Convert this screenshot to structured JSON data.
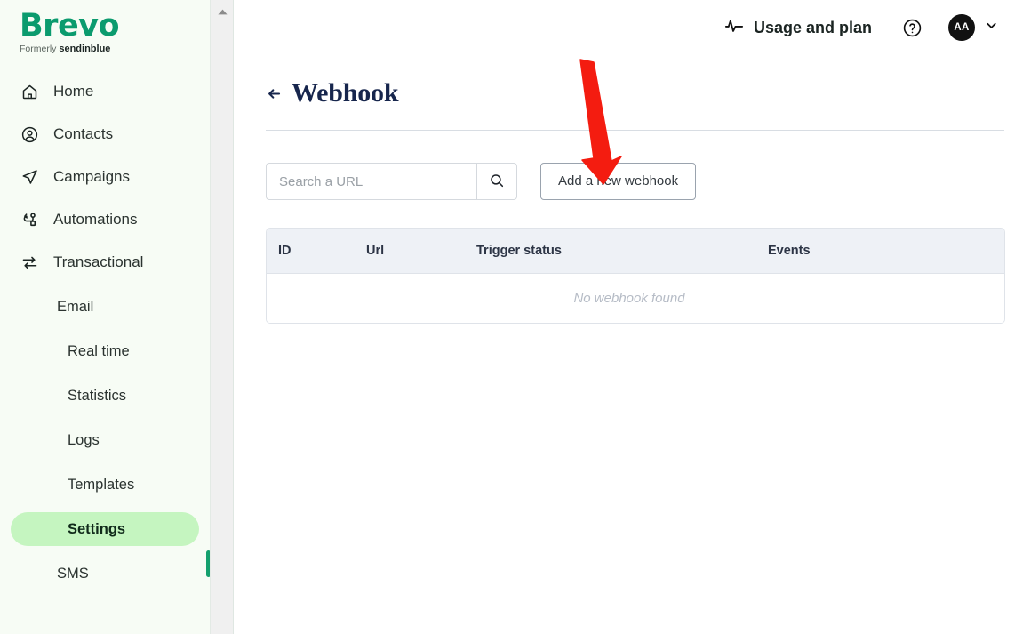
{
  "sidebar": {
    "logo": {
      "word": "Brevo",
      "formerly_prefix": "Formerly",
      "formerly_brand": "sendinblue"
    },
    "items": [
      {
        "label": "Home",
        "icon": "home-icon",
        "level": 1,
        "active": false
      },
      {
        "label": "Contacts",
        "icon": "contacts-icon",
        "level": 1,
        "active": false
      },
      {
        "label": "Campaigns",
        "icon": "campaigns-icon",
        "level": 1,
        "active": false
      },
      {
        "label": "Automations",
        "icon": "automations-icon",
        "level": 1,
        "active": false
      },
      {
        "label": "Transactional",
        "icon": "transactional-icon",
        "level": 1,
        "active": false
      },
      {
        "label": "Email",
        "icon": "",
        "level": 2,
        "active": false
      },
      {
        "label": "Real time",
        "icon": "",
        "level": 3,
        "active": false
      },
      {
        "label": "Statistics",
        "icon": "",
        "level": 3,
        "active": false
      },
      {
        "label": "Logs",
        "icon": "",
        "level": 3,
        "active": false
      },
      {
        "label": "Templates",
        "icon": "",
        "level": 3,
        "active": false
      },
      {
        "label": "Settings",
        "icon": "",
        "level": 3,
        "active": true
      },
      {
        "label": "SMS",
        "icon": "",
        "level": 2,
        "active": false
      }
    ]
  },
  "header": {
    "usage_label": "Usage and plan",
    "usage_icon": "activity-pulse-icon",
    "help_icon": "help-circle-icon",
    "avatar_initials": "AA",
    "chevron_icon": "chevron-down-icon"
  },
  "page": {
    "back_icon": "arrow-left-icon",
    "title": "Webhook"
  },
  "toolbar": {
    "search_placeholder": "Search a URL",
    "search_value": "",
    "search_icon": "search-icon",
    "add_button_label": "Add a new webhook"
  },
  "table": {
    "columns": [
      "ID",
      "Url",
      "Trigger status",
      "Events"
    ],
    "rows": [],
    "empty_message": "No webhook found"
  },
  "scrollbar": {
    "up_arrow_icon": "scroll-up-arrow-icon"
  },
  "annotation": {
    "arrow_color": "#f41c10",
    "points_to": "Add a new webhook"
  },
  "colors": {
    "brand_green": "#0b9b6e",
    "active_pill": "#c5f5c0",
    "active_marker": "#14a06e",
    "sidebar_bg": "#f7fcf5",
    "title_navy": "#17264d",
    "table_header_bg": "#eef1f6"
  }
}
